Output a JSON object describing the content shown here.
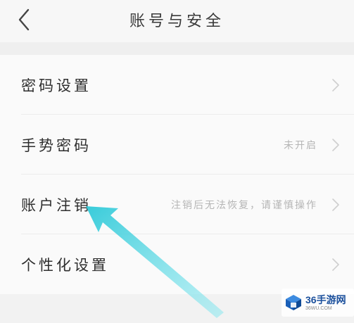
{
  "header": {
    "title": "账号与安全",
    "back_icon": "chevron-left-icon"
  },
  "settings": {
    "items": [
      {
        "label": "密码设置",
        "value": "",
        "icon": "chevron-right-icon"
      },
      {
        "label": "手势密码",
        "value": "未开启",
        "icon": "chevron-right-icon"
      },
      {
        "label": "账户注销",
        "value": "注销后无法恢复，请谨慎操作",
        "icon": "chevron-right-icon"
      },
      {
        "label": "个性化设置",
        "value": "",
        "icon": "chevron-right-icon"
      }
    ]
  },
  "annotation": {
    "icon": "arrow-pointer-icon",
    "color": "#3fd3e0"
  },
  "watermark": {
    "name": "36手游网",
    "url": "36WU.COM",
    "logo_color": "#1a6fd1"
  }
}
